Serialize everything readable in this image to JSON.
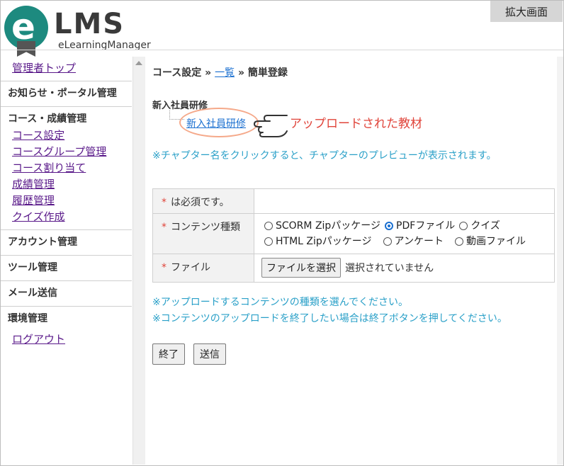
{
  "header": {
    "logo_mark": "e",
    "logo_title": "LMS",
    "logo_subtitle": "eLearningManager",
    "zoom_label": "拡大画面"
  },
  "sidebar": {
    "top_link": "管理者トップ",
    "sections": [
      {
        "heading": "お知らせ・ポータル管理",
        "links": []
      },
      {
        "heading": "コース・成績管理",
        "links": [
          "コース設定",
          "コースグループ管理",
          "コース割り当て",
          "成績管理",
          "履歴管理",
          "クイズ作成"
        ]
      },
      {
        "heading": "アカウント管理",
        "links": []
      },
      {
        "heading": "ツール管理",
        "links": []
      },
      {
        "heading": "メール送信",
        "links": []
      },
      {
        "heading": "環境管理",
        "links": []
      }
    ],
    "logout_link": "ログアウト"
  },
  "main": {
    "breadcrumb": {
      "part1": "コース設定 » ",
      "link": "一覧",
      "part2": " » 簡単登録"
    },
    "course_title": "新入社員研修",
    "chapter_link": "新入社員研修",
    "annotation": "アップロードされた教材",
    "chapter_note": "※チャプター名をクリックすると、チャプターのプレビューが表示されます。",
    "form": {
      "required_mark": "*",
      "required_note": "は必須です。",
      "content_type_label": "コンテンツ種類",
      "content_types": [
        {
          "label": "SCORM Zipパッケージ",
          "checked": false
        },
        {
          "label": "PDFファイル",
          "checked": true
        },
        {
          "label": "クイズ",
          "checked": false
        },
        {
          "label": "HTML Zipパッケージ",
          "checked": false
        },
        {
          "label": "アンケート",
          "checked": false
        },
        {
          "label": "動画ファイル",
          "checked": false
        }
      ],
      "file_label": "ファイル",
      "file_button": "ファイルを選択",
      "file_status": "選択されていません"
    },
    "notes": [
      "※アップロードするコンテンツの種類を選んでください。",
      "※コンテンツのアップロードを終了したい場合は終了ボタンを押してください。"
    ],
    "buttons": {
      "finish": "終了",
      "send": "送信"
    }
  },
  "colors": {
    "brand": "#1d8a7f",
    "link": "#1a6fd0",
    "note": "#2aa0c8",
    "annotation": "#e0443a"
  }
}
